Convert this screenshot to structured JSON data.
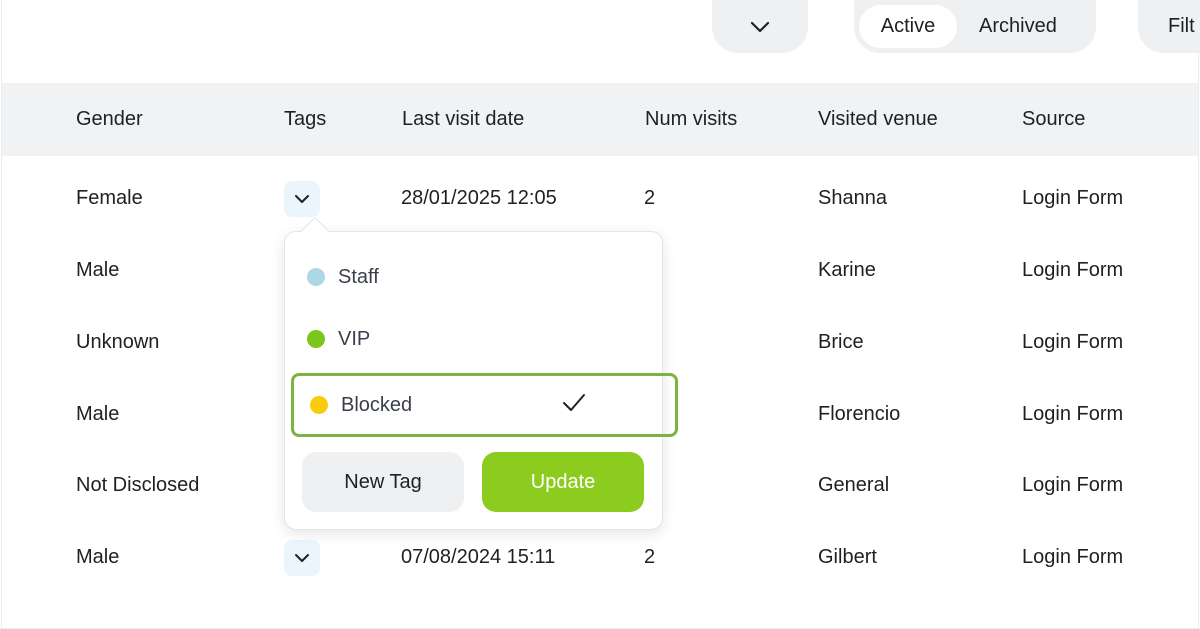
{
  "toolbar": {
    "dropdown_icon": "chevron-down-icon",
    "segments": [
      {
        "label": "Active",
        "active": true
      },
      {
        "label": "Archived",
        "active": false
      }
    ],
    "filter_label": "Filt"
  },
  "table": {
    "columns": [
      "Gender",
      "Tags",
      "Last visit date",
      "Num visits",
      "Visited venue",
      "Source"
    ],
    "rows": [
      {
        "gender": "Female",
        "last_visit": "28/01/2025 12:05",
        "visits": "2",
        "venue": "Shanna",
        "source": "Login Form"
      },
      {
        "gender": "Male",
        "last_visit": "",
        "visits": "",
        "venue": "Karine",
        "source": "Login Form"
      },
      {
        "gender": "Unknown",
        "last_visit": "",
        "visits": "",
        "venue": "Brice",
        "source": "Login Form"
      },
      {
        "gender": "Male",
        "last_visit": "",
        "visits": "",
        "venue": "Florencio",
        "source": "Login Form"
      },
      {
        "gender": "Not Disclosed",
        "last_visit": "",
        "visits": "",
        "venue": "General",
        "source": "Login Form"
      },
      {
        "gender": "Male",
        "last_visit": "07/08/2024 15:11",
        "visits": "2",
        "venue": "Gilbert",
        "source": "Login Form"
      }
    ]
  },
  "tags_popover": {
    "options": [
      {
        "label": "Staff",
        "color": "#add8e6",
        "selected": false
      },
      {
        "label": "VIP",
        "color": "#7cc51c",
        "selected": false
      },
      {
        "label": "Blocked",
        "color": "#f8cc0a",
        "selected": true
      }
    ],
    "new_tag_label": "New Tag",
    "update_label": "Update"
  },
  "colors": {
    "accent_green": "#8ccc1e",
    "selected_border": "#7cb342",
    "header_bg": "#f1f2f4"
  }
}
